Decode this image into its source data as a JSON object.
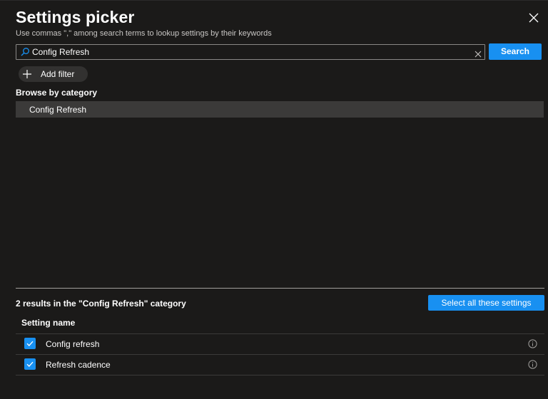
{
  "dialog": {
    "title": "Settings picker",
    "subtitle": "Use commas \",\" among search terms to lookup settings by their keywords"
  },
  "search": {
    "value": "Config Refresh",
    "button_label": "Search"
  },
  "filter": {
    "add_label": "Add filter"
  },
  "browse": {
    "heading": "Browse by category",
    "categories": [
      {
        "label": "Config Refresh",
        "selected": true
      }
    ]
  },
  "results": {
    "summary": "2 results in the \"Config Refresh\" category",
    "select_all_label": "Select all these settings",
    "column_header": "Setting name",
    "rows": [
      {
        "label": "Config refresh",
        "checked": true
      },
      {
        "label": "Refresh cadence",
        "checked": true
      }
    ]
  },
  "colors": {
    "background": "#1b1a19",
    "accent": "#1890f1",
    "selected_row": "#3b3a39"
  },
  "icons": {
    "close": "close-icon",
    "search": "search-icon",
    "clear": "clear-icon",
    "add": "plus-icon",
    "check": "checkmark-icon",
    "info": "info-icon"
  }
}
